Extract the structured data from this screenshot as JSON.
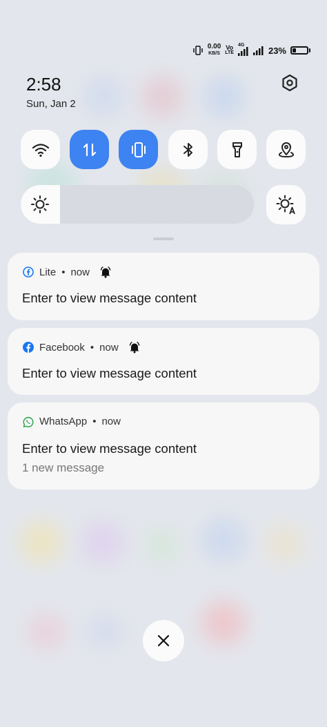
{
  "status_bar": {
    "net_speed_value": "0.00",
    "net_speed_unit": "KB/S",
    "volte_top": "Vo",
    "volte_bottom": "LTE",
    "network_type": "4G",
    "battery_percent": "23%",
    "battery_level": 0.23
  },
  "header": {
    "time": "2:58",
    "date": "Sun, Jan 2"
  },
  "quick_settings": {
    "tiles": [
      {
        "name": "wifi-icon",
        "active": false
      },
      {
        "name": "mobile-data-icon",
        "active": true
      },
      {
        "name": "vibrate-icon",
        "active": true
      },
      {
        "name": "bluetooth-icon",
        "active": false
      },
      {
        "name": "flashlight-icon",
        "active": false
      },
      {
        "name": "location-icon",
        "active": false
      }
    ],
    "brightness_level": 0.17,
    "accent_color": "#3d83f1"
  },
  "notifications": [
    {
      "app": "Lite",
      "separator": "•",
      "time": "now",
      "alert_icon": "bell-icon",
      "title": "Enter to view message content",
      "subtitle": ""
    },
    {
      "app": "Facebook",
      "separator": "•",
      "time": "now",
      "alert_icon": "bell-icon",
      "title": "Enter to view message content",
      "subtitle": ""
    },
    {
      "app": "WhatsApp",
      "separator": "•",
      "time": "now",
      "title": "Enter to view message content",
      "subtitle": "1 new message"
    }
  ]
}
